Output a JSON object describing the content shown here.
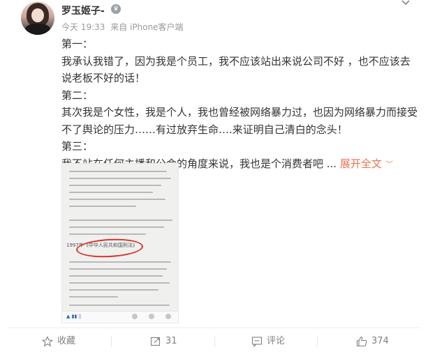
{
  "post": {
    "username": "罗玉姬子-",
    "time": "今天 19:33",
    "source": "来自 iPhone客户端",
    "paragraphs": [
      "第一：",
      "我承认我错了，因为我是个员工，我不应该站出来说公司不好 ，也不应该去说老板不好的话！",
      "第二：",
      "其次我是个女性，我是个人，我也曾经被网络暴力过，也因为网络暴力而接受不了舆论的压力……有过放弃生命….来证明自己清白的念头！",
      "第三：",
      "我不站在任何主播和公会的角度来说，我也是个消费者吧 ..."
    ],
    "expand_label": "展开全文",
    "image_law_text": "1997年《中华人民共和国刑法》"
  },
  "footer": {
    "favorite_label": "收藏",
    "repost_count": "31",
    "comment_label": "评论",
    "like_count": "374"
  },
  "colors": {
    "accent": "#eb7350",
    "muted": "#808080",
    "oval": "#d9342b"
  }
}
